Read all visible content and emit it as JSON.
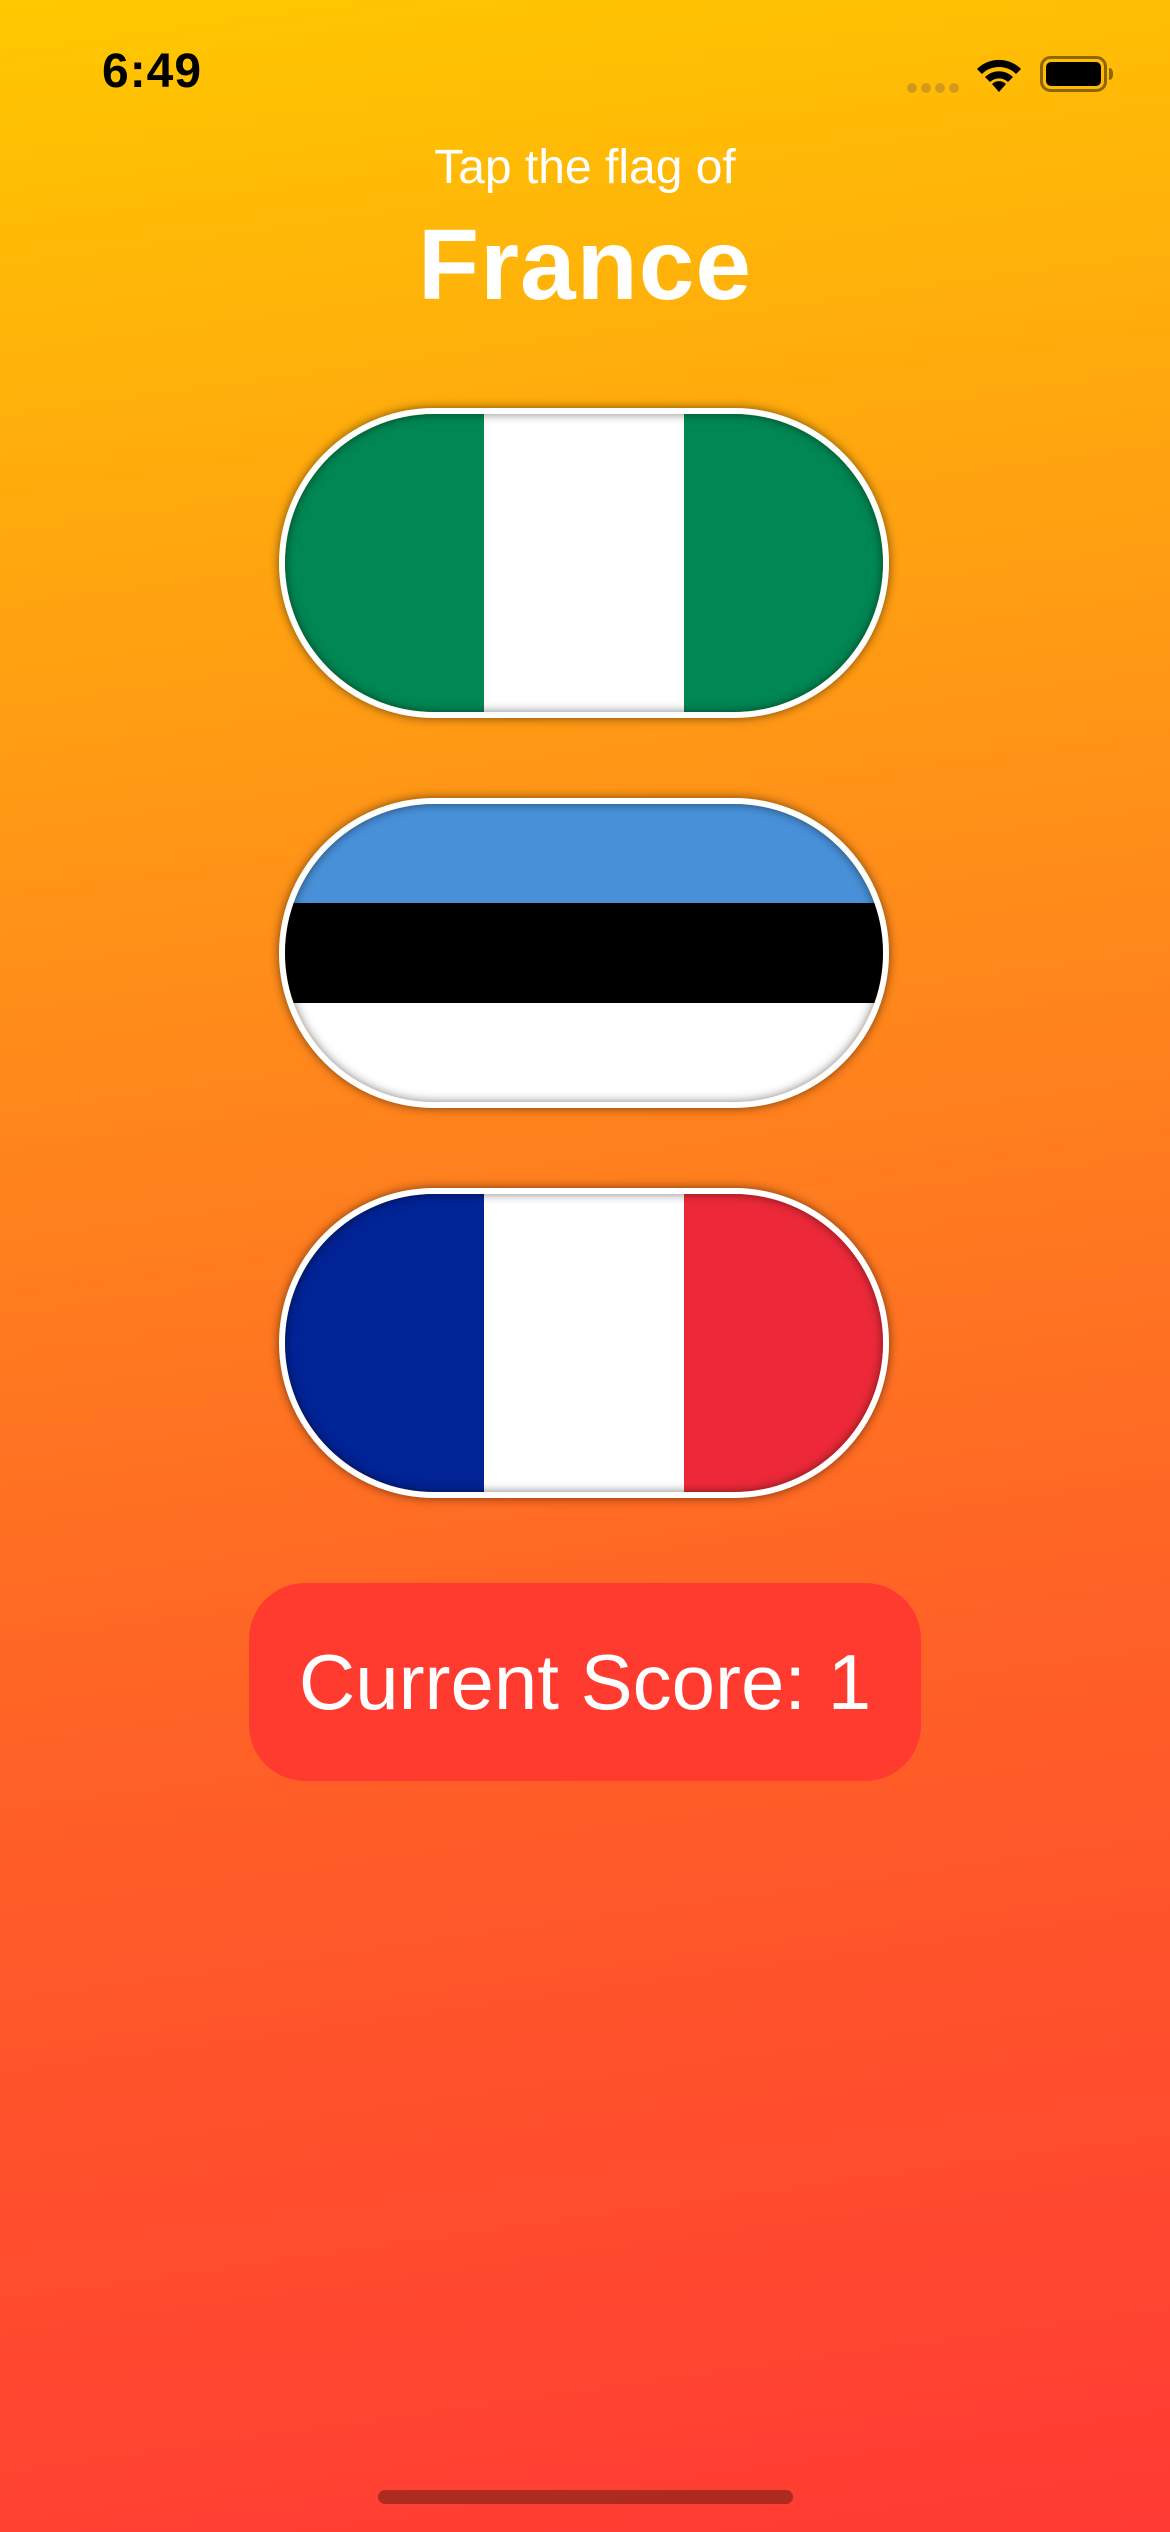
{
  "status_bar": {
    "time": "6:49",
    "signal_icon": "cellular-signal-icon",
    "wifi_icon": "wifi-icon",
    "battery_icon": "battery-icon"
  },
  "header": {
    "prompt": "Tap the flag of",
    "country": "France"
  },
  "flags": [
    {
      "icon": "nigeria-flag-icon",
      "orientation": "vertical",
      "colors": [
        "#008753",
        "#ffffff",
        "#008753"
      ]
    },
    {
      "icon": "estonia-flag-icon",
      "orientation": "horizontal",
      "colors": [
        "#4891d9",
        "#000000",
        "#ffffff"
      ]
    },
    {
      "icon": "france-flag-icon",
      "orientation": "vertical",
      "colors": [
        "#002395",
        "#ffffff",
        "#ed2939"
      ]
    }
  ],
  "score": {
    "label": "Current Score: 1"
  },
  "colors": {
    "gradient_top": "#ffc800",
    "gradient_bottom": "#ff3a34",
    "score_background": "#ff3b30",
    "text": "#ffffff"
  }
}
